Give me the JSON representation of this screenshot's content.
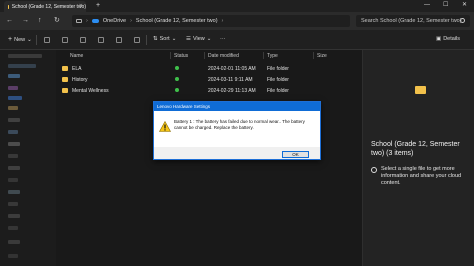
{
  "tab": {
    "title": "School (Grade 12, Semester two)",
    "close": "✕",
    "new": "+"
  },
  "window": {
    "minimize": "—",
    "maximize": "☐",
    "close": "✕"
  },
  "nav": {
    "back": "←",
    "forward": "→",
    "up": "↑",
    "refresh": "↻"
  },
  "breadcrumb": {
    "root": "OneDrive",
    "sep1": "›",
    "folder": "School (Grade 12, Semester two)",
    "sep2": "›"
  },
  "search": {
    "placeholder": "Search School (Grade 12, Semester two)"
  },
  "toolbar": {
    "new_label": "New",
    "sort_label": "Sort",
    "view_label": "View",
    "more_label": "···",
    "details_label": "Details",
    "chevron": "⌄"
  },
  "columns": {
    "name": "Name",
    "status": "Status",
    "date": "Date modified",
    "type": "Type",
    "size": "Size"
  },
  "files": [
    {
      "name": "ELA",
      "date": "2024-02-01 11:05 AM",
      "type": "File folder"
    },
    {
      "name": "History",
      "date": "2024-03-11 9:11 AM",
      "type": "File folder"
    },
    {
      "name": "Mental Wellness",
      "date": "2024-02-29 11:13 AM",
      "type": "File folder"
    }
  ],
  "details_pane": {
    "title": "School (Grade 12, Semester two) (3 items)",
    "info": "Select a single file to get more information and share your cloud content."
  },
  "dialog": {
    "title": "Lenovo Hardware Settings",
    "message": "Battery 1 : The battery has failed due to normal wear.. The battery cannot be charged. Replace the battery.",
    "ok_label": "OK"
  },
  "colors": {
    "accent": "#0f6cd6",
    "folder": "#f2c14b",
    "synced": "#3fc04b"
  }
}
